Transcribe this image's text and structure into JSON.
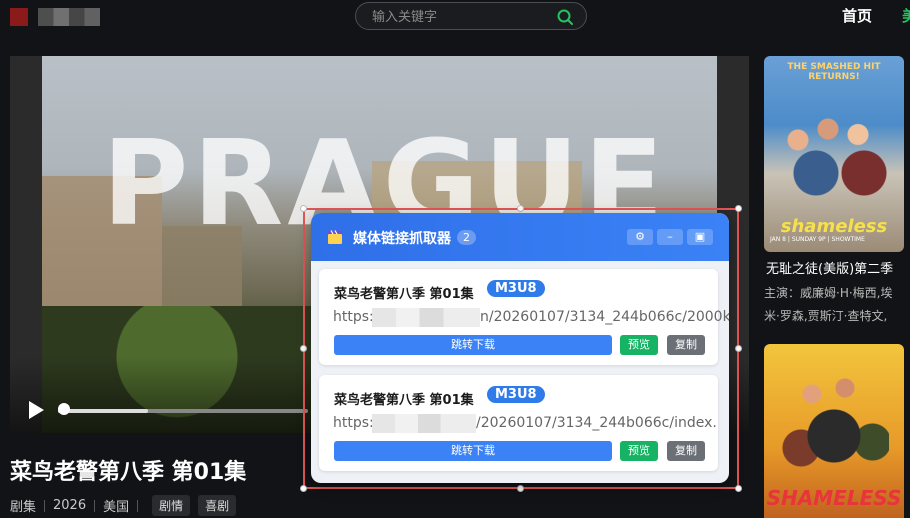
{
  "header": {
    "search_placeholder": "输入关键字",
    "nav": [
      {
        "label": "首页"
      },
      {
        "label": "美"
      }
    ]
  },
  "player": {
    "overlay_text": "PRAGUE",
    "progress": 0.36
  },
  "episode": {
    "title": "菜鸟老警第八季 第01集",
    "type": "剧集",
    "year": "2026",
    "region": "美国",
    "tags": [
      "剧情",
      "喜剧"
    ]
  },
  "sidebar": {
    "item1": {
      "poster_top": "THE SMASHED HIT RETURNS!",
      "poster_logo": "shameless",
      "poster_small": "JAN 8 | SUNDAY 9P | SHOWTIME",
      "title": "无耻之徒(美版)第二季",
      "cast_line1": "主演：威廉姆·H·梅西,埃",
      "cast_line2": "米·罗森,贾斯汀·查特文,"
    },
    "item2": {
      "poster_logo": "SHAMELESS"
    }
  },
  "panel": {
    "title": "媒体链接抓取器",
    "count": "2",
    "header_buttons": {
      "settings": "⚙",
      "minimize": "–",
      "close": "▣"
    },
    "items": [
      {
        "title": "菜鸟老警第八季 第01集",
        "badge": "M3U8",
        "url_prefix": "https:",
        "url_suffix": "n/20260107/3134_244b066c/2000k",
        "download_label": "跳转下载",
        "preview_label": "预览",
        "copy_label": "复制"
      },
      {
        "title": "菜鸟老警第八季 第01集",
        "badge": "M3U8",
        "url_prefix": "https:",
        "url_suffix": "/20260107/3134_244b066c/index.",
        "download_label": "跳转下载",
        "preview_label": "预览",
        "copy_label": "复制"
      }
    ]
  },
  "colors": {
    "accent_blue": "#3b82f6",
    "preview_green": "#16b364",
    "copy_gray": "#6b6f76",
    "selection_red": "#e25656",
    "search_icon_green": "#22c55e"
  }
}
